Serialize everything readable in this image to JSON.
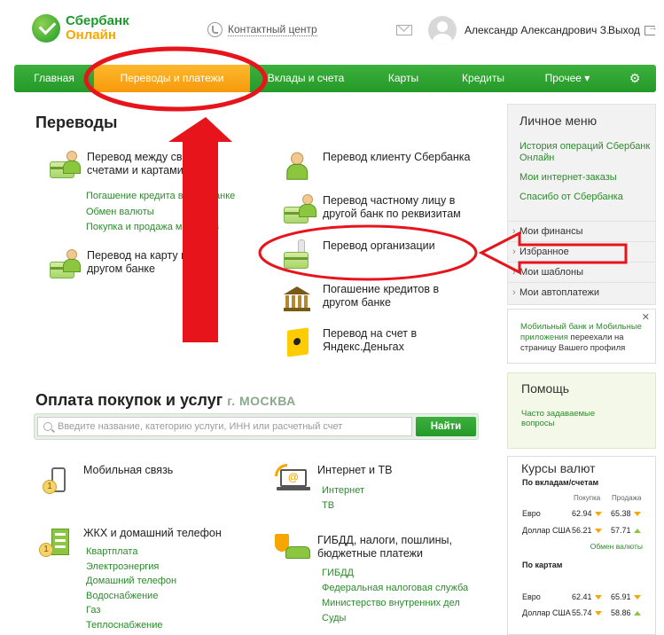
{
  "header": {
    "logo_line1": "Сбербанк",
    "logo_line2": "Онлайн",
    "contact_center": "Контактный центр",
    "user_name": "Александр Александрович З.",
    "logout": "Выход"
  },
  "nav": {
    "items": [
      {
        "label": "Главная"
      },
      {
        "label": "Переводы и платежи"
      },
      {
        "label": "Вклады и счета"
      },
      {
        "label": "Карты"
      },
      {
        "label": "Кредиты"
      },
      {
        "label": "Прочее ▾"
      }
    ]
  },
  "transfers": {
    "title": "Переводы",
    "own_accounts": "Перевод между своими счетами и картами",
    "own_sublinks": [
      "Погашение кредита в Сбербанке",
      "Обмен валюты",
      "Покупка и продажа металлов"
    ],
    "other_bank_card": "Перевод на карту в другом банке",
    "sber_client": "Перевод клиенту Сбербанка",
    "private_person": "Перевод частному лицу в другой банк по реквизитам",
    "organization": "Перевод организации",
    "loan_other_bank": "Погашение кредитов в другом банке",
    "yandex": "Перевод на счет в Яндекс.Деньгах"
  },
  "payments": {
    "title": "Оплата покупок и услуг",
    "city": "г. МОСКВА",
    "search_placeholder": "Введите название, категорию услуги, ИНН или расчетный счет",
    "find_button": "Найти",
    "mobile": "Мобильная связь",
    "housing": "ЖКХ и домашний телефон",
    "housing_sublinks": [
      "Квартплата",
      "Электроэнергия",
      "Домашний телефон",
      "Водоснабжение",
      "Газ",
      "Теплоснабжение"
    ],
    "internet": "Интернет и ТВ",
    "internet_sublinks": [
      "Интернет",
      "ТВ"
    ],
    "gibdd": "ГИБДД, налоги, пошлины, бюджетные платежи",
    "gibdd_sublinks": [
      "ГИБДД",
      "Федеральная налоговая служба",
      "Министерство внутренних дел",
      "Суды"
    ]
  },
  "personal_menu": {
    "title": "Личное меню",
    "links": [
      "История операций Сбербанк Онлайн",
      "Мои интернет-заказы",
      "Спасибо от Сбербанка"
    ],
    "items": [
      "Мои финансы",
      "Избранное",
      "Мои шаблоны",
      "Мои автоплатежи"
    ]
  },
  "notice": {
    "link": "Мобильный банк и Мобильные приложения",
    "text": "переехали на страницу Вашего профиля"
  },
  "help": {
    "title": "Помощь",
    "faq": "Часто задаваемые вопросы"
  },
  "rates": {
    "title": "Курсы валют",
    "deposits_caption": "По вкладам/счетам",
    "buy_header": "Покупка",
    "sell_header": "Продажа",
    "deposit_rows": [
      {
        "name": "Евро",
        "buy": "62.94",
        "sell": "65.38"
      },
      {
        "name": "Доллар США",
        "buy": "56.21",
        "sell": "57.71"
      }
    ],
    "exchange_link": "Обмен валюты",
    "cards_caption": "По картам",
    "card_rows": [
      {
        "name": "Евро",
        "buy": "62.41",
        "sell": "65.91"
      },
      {
        "name": "Доллар США",
        "buy": "55.74",
        "sell": "58.86"
      }
    ]
  },
  "colors": {
    "brand_green": "#249a28",
    "accent_orange": "#f59a0a",
    "link_green": "#2c8a2c",
    "annotation_red": "#e8141b"
  }
}
